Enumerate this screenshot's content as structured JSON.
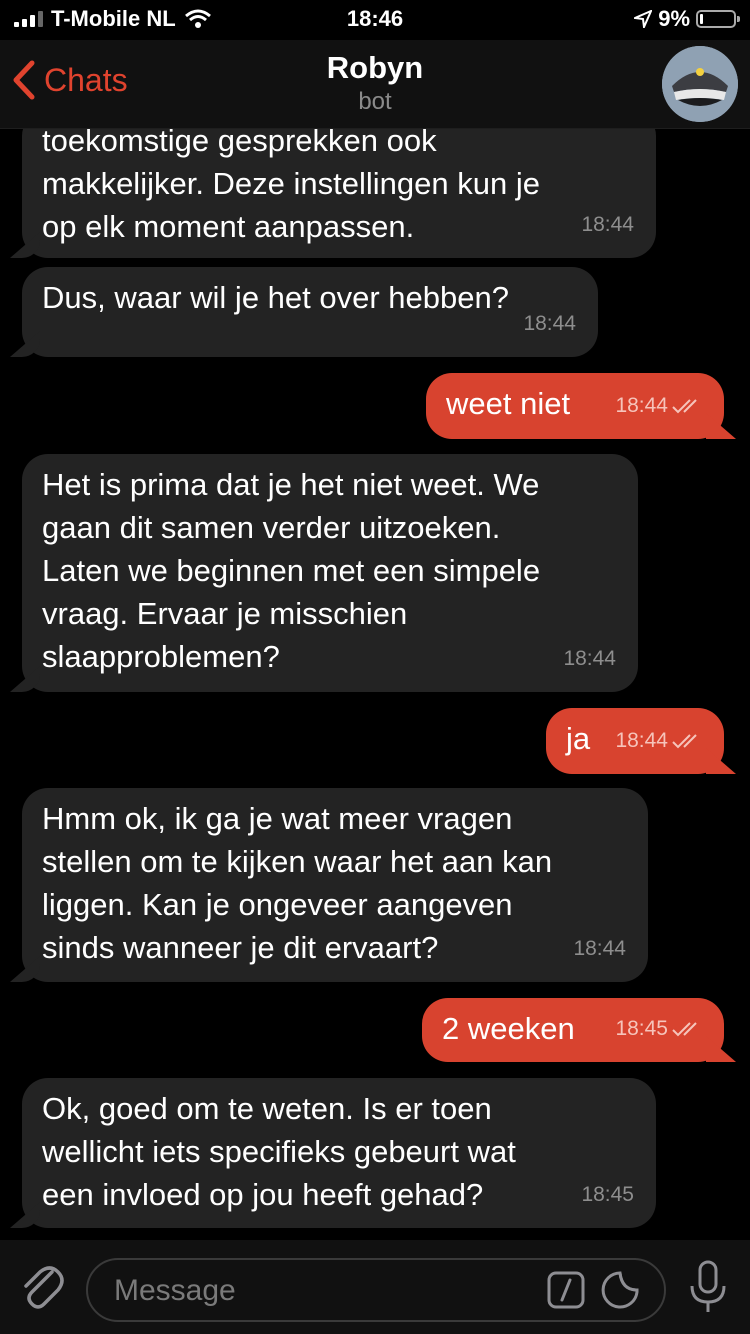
{
  "status": {
    "carrier": "T-Mobile NL",
    "time": "18:46",
    "battery": "9%",
    "battery_level": 0.09
  },
  "header": {
    "back_label": "Chats",
    "title": "Robyn",
    "subtitle": "bot"
  },
  "messages": [
    {
      "dir": "in",
      "text": "toekomstige gesprekken ook\nmakkelijker. Deze instellingen kun je\nop elk moment aanpassen.",
      "time": "18:44"
    },
    {
      "dir": "in",
      "text": "Dus, waar wil je het over hebben?",
      "time": "18:44"
    },
    {
      "dir": "out",
      "text": "weet niet",
      "time": "18:44"
    },
    {
      "dir": "in",
      "text": "Het is prima dat je het niet weet. We\ngaan dit samen verder uitzoeken.\nLaten we beginnen met een simpele\nvraag. Ervaar je misschien\nslaapproblemen?",
      "time": "18:44"
    },
    {
      "dir": "out",
      "text": "ja",
      "time": "18:44"
    },
    {
      "dir": "in",
      "text": "Hmm ok, ik ga je wat meer vragen\nstellen om te kijken waar het aan kan\nliggen. Kan je ongeveer aangeven\nsinds wanneer je dit ervaart?",
      "time": "18:44"
    },
    {
      "dir": "out",
      "text": "2 weeken",
      "time": "18:45"
    },
    {
      "dir": "in",
      "text": "Ok, goed om te weten. Is er toen\nwellicht iets specifieks gebeurt wat\neen invloed op jou heeft gehad?",
      "time": "18:45"
    }
  ],
  "input": {
    "placeholder": "Message"
  }
}
